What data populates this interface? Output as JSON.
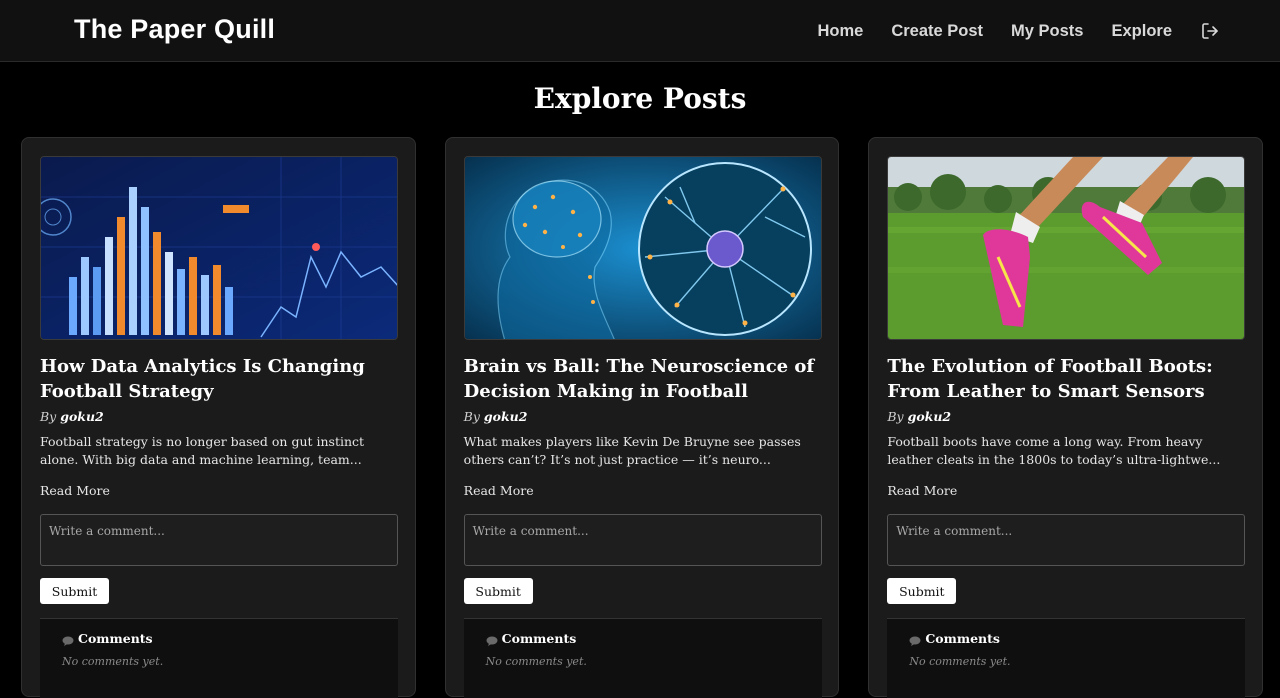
{
  "navbar": {
    "brand": "The Paper Quill",
    "links": [
      "Home",
      "Create Post",
      "My Posts",
      "Explore"
    ],
    "logout_icon": "logout-icon"
  },
  "page": {
    "title": "Explore Posts"
  },
  "posts": [
    {
      "image": "data-analytics-chart-image",
      "title": "How Data Analytics Is Changing Football Strategy",
      "by_label": "By",
      "author": "goku2",
      "excerpt": "Football strategy is no longer based on gut instinct alone. With big data and machine learning, team...",
      "read_more": "Read More",
      "comment_placeholder": "Write a comment...",
      "submit_label": "Submit",
      "comments_heading": "Comments",
      "no_comments": "No comments yet."
    },
    {
      "image": "brain-neuron-image",
      "title": "Brain vs Ball: The Neuroscience of Decision Making in Football",
      "by_label": "By",
      "author": "goku2",
      "excerpt": "What makes players like Kevin De Bruyne see passes others can’t? It’s not just practice — it’s neuro...",
      "read_more": "Read More",
      "comment_placeholder": "Write a comment...",
      "submit_label": "Submit",
      "comments_heading": "Comments",
      "no_comments": "No comments yet."
    },
    {
      "image": "football-boots-image",
      "title": "The Evolution of Football Boots: From Leather to Smart Sensors",
      "by_label": "By",
      "author": "goku2",
      "excerpt": "Football boots have come a long way. From heavy leather cleats in the 1800s to today’s ultra-lightwe...",
      "read_more": "Read More",
      "comment_placeholder": "Write a comment...",
      "submit_label": "Submit",
      "comments_heading": "Comments",
      "no_comments": "No comments yet."
    }
  ],
  "colors": {
    "background": "#000000",
    "navbar": "#111111",
    "card": "#1b1b1b",
    "button": "#ffffff"
  }
}
